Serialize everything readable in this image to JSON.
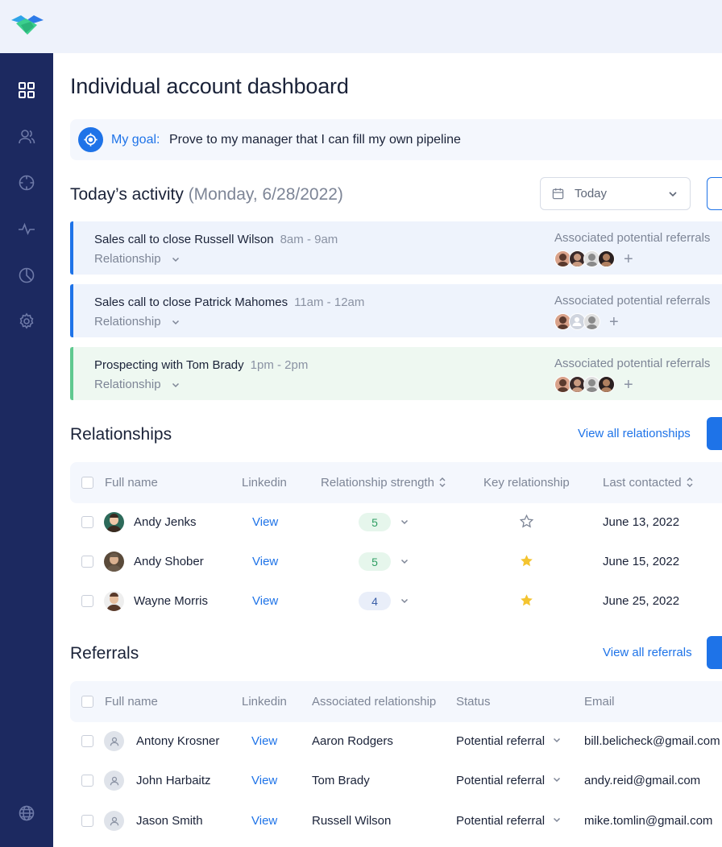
{
  "page": {
    "title": "Individual account dashboard"
  },
  "goal": {
    "label": "My goal:",
    "text": "Prove to my manager that I can fill my own pipeline"
  },
  "activity": {
    "heading": "Today’s activity",
    "date": "(Monday, 6/28/2022)",
    "date_filter": "Today",
    "items": [
      {
        "title": "Sales call to close Russell Wilson",
        "time": "8am - 9am",
        "type": "Relationship",
        "assoc_label": "Associated potential referrals",
        "accent": "#1e73e8",
        "bg": "#eef3fc"
      },
      {
        "title": "Sales call to close Patrick Mahomes",
        "time": "11am - 12am",
        "type": "Relationship",
        "assoc_label": "Associated potential referrals",
        "accent": "#1e73e8",
        "bg": "#eef3fc"
      },
      {
        "title": "Prospecting with Tom Brady",
        "time": "1pm - 2pm",
        "type": "Relationship",
        "assoc_label": "Associated potential referrals",
        "accent": "#5fc98f",
        "bg": "#eef8f1"
      }
    ]
  },
  "relationships": {
    "heading": "Relationships",
    "view_all": "View all relationships",
    "columns": [
      "Full name",
      "Linkedin",
      "Relationship strength",
      "Key relationship",
      "Last contacted"
    ],
    "rows": [
      {
        "name": "Andy Jenks",
        "linkedin": "View",
        "strength": "5",
        "key": false,
        "last": "June 13, 2022"
      },
      {
        "name": "Andy Shober",
        "linkedin": "View",
        "strength": "5",
        "key": true,
        "last": "June 15, 2022"
      },
      {
        "name": "Wayne Morris",
        "linkedin": "View",
        "strength": "4",
        "key": true,
        "last": "June 25, 2022"
      }
    ]
  },
  "referrals": {
    "heading": "Referrals",
    "view_all": "View all referrals",
    "columns": [
      "Full name",
      "Linkedin",
      "Associated relationship",
      "Status",
      "Email"
    ],
    "rows": [
      {
        "name": "Antony Krosner",
        "linkedin": "View",
        "relationship": "Aaron Rodgers",
        "status": "Potential referral",
        "email": "bill.belicheck@gmail.com"
      },
      {
        "name": "John Harbaitz",
        "linkedin": "View",
        "relationship": "Tom Brady",
        "status": "Potential referral",
        "email": "andy.reid@gmail.com"
      },
      {
        "name": "Jason Smith",
        "linkedin": "View",
        "relationship": "Russell Wilson",
        "status": "Potential referral",
        "email": "mike.tomlin@gmail.com"
      }
    ]
  },
  "colors": {
    "sidebar": "#1c2960",
    "accent": "#1e73e8",
    "green": "#5fc98f",
    "star": "#f4c430"
  },
  "icons": [
    "handshake-logo",
    "dashboard-icon",
    "people-icon",
    "target-icon",
    "activity-icon",
    "pie-chart-icon",
    "gear-icon",
    "globe-icon",
    "calendar-icon",
    "chevron-down-icon",
    "star-icon",
    "user-placeholder-icon"
  ]
}
